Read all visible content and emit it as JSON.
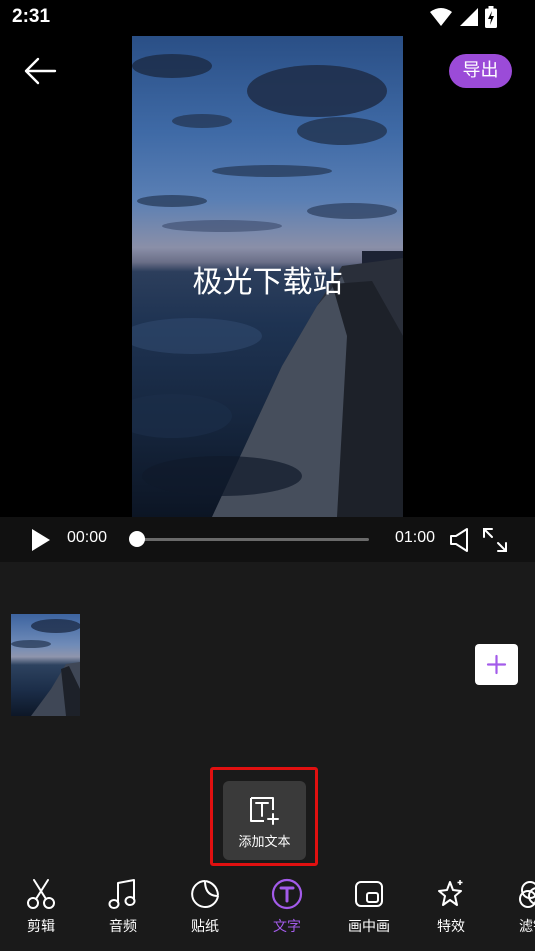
{
  "status_bar": {
    "time": "2:31"
  },
  "preview": {
    "overlay_text": "极光下载站"
  },
  "header": {
    "export_label": "导出"
  },
  "player": {
    "current_time": "00:00",
    "duration": "01:00",
    "progress": 0.0
  },
  "add_text": {
    "label": "添加文本"
  },
  "toolbar": {
    "items": [
      {
        "label": "剪辑",
        "icon": "scissors-icon"
      },
      {
        "label": "音频",
        "icon": "music-note-icon"
      },
      {
        "label": "贴纸",
        "icon": "sticker-icon"
      },
      {
        "label": "文字",
        "icon": "text-icon"
      },
      {
        "label": "画中画",
        "icon": "picture-in-picture-icon"
      },
      {
        "label": "特效",
        "icon": "sparkle-icon"
      },
      {
        "label": "滤镜",
        "icon": "filter-icon"
      }
    ],
    "active_index": 3
  },
  "colors": {
    "accent": "#9b4bd8",
    "highlight": "#e01010"
  }
}
